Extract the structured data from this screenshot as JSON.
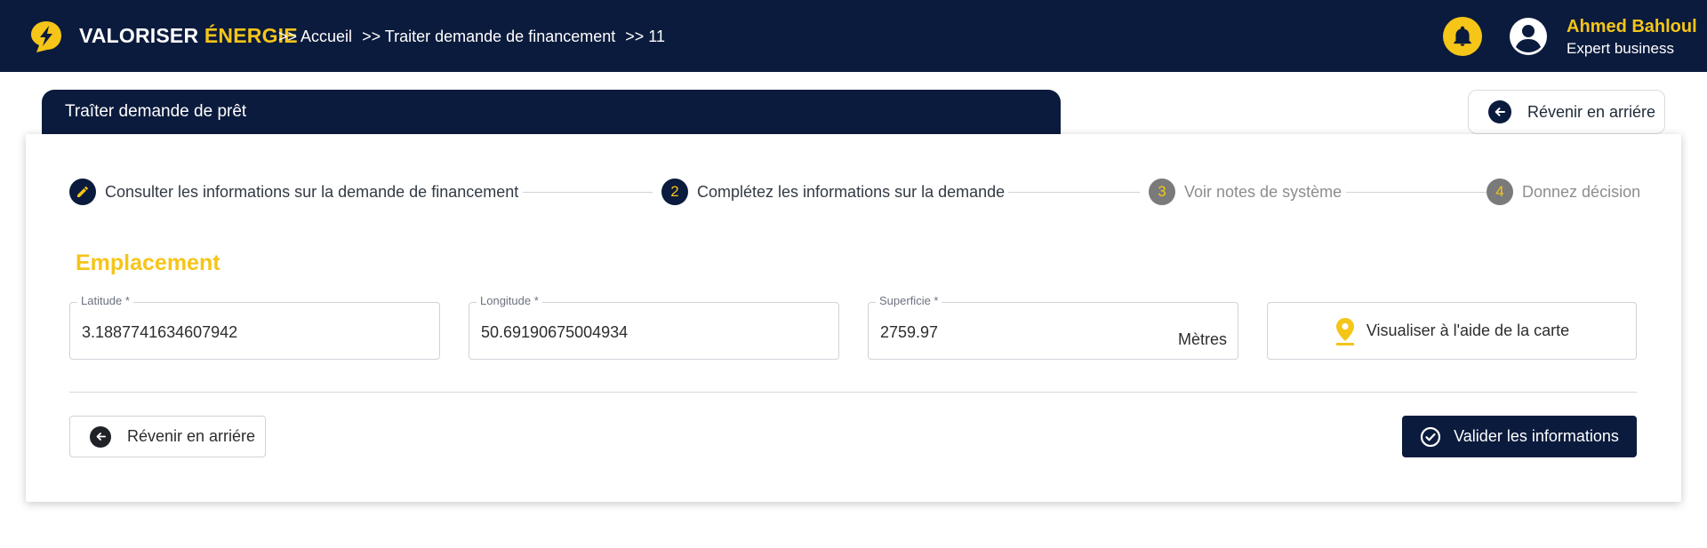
{
  "header": {
    "brand_primary": "VALORISER",
    "brand_accent": "ÉNERGIE",
    "breadcrumb": [
      ">> Accueil",
      ">> Traiter demande de financement",
      ">> 11"
    ],
    "user": {
      "name": "Ahmed Bahloul",
      "role": "Expert business"
    }
  },
  "card": {
    "title": "Traîter demande de prêt",
    "back_label": "Révenir en arriére"
  },
  "stepper": [
    {
      "label": "Consulter les informations sur la demande de financement",
      "state": "done",
      "badge": ""
    },
    {
      "label": "Complétez les informations sur la demande",
      "state": "active",
      "badge": "2"
    },
    {
      "label": "Voir notes de système",
      "state": "inactive",
      "badge": "3"
    },
    {
      "label": "Donnez décision",
      "state": "inactive",
      "badge": "4"
    }
  ],
  "section": {
    "title": "Emplacement",
    "fields": {
      "latitude": {
        "label": "Latitude *",
        "value": "3.1887741634607942"
      },
      "longitude": {
        "label": "Longitude *",
        "value": "50.69190675004934"
      },
      "superficie": {
        "label": "Superficie *",
        "value": "2759.97",
        "unit": "Mètres"
      }
    },
    "map_button": "Visualiser à l'aide de la carte"
  },
  "actions": {
    "back": "Révenir en arriére",
    "validate": "Valider les informations"
  },
  "colors": {
    "navy": "#0b1b3d",
    "accent": "#f5c518",
    "muted": "#7a7a7a"
  }
}
